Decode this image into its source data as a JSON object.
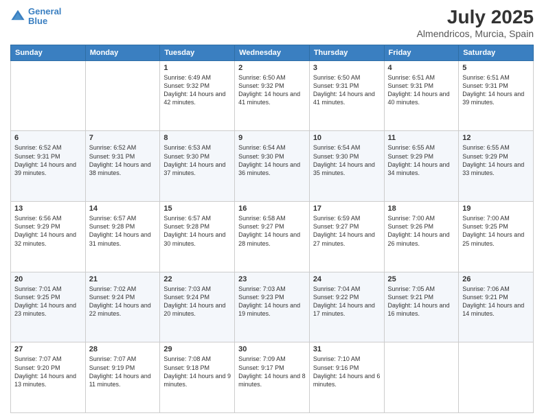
{
  "header": {
    "logo_line1": "General",
    "logo_line2": "Blue",
    "month_year": "July 2025",
    "location": "Almendricos, Murcia, Spain"
  },
  "weekdays": [
    "Sunday",
    "Monday",
    "Tuesday",
    "Wednesday",
    "Thursday",
    "Friday",
    "Saturday"
  ],
  "weeks": [
    [
      {
        "day": "",
        "info": ""
      },
      {
        "day": "",
        "info": ""
      },
      {
        "day": "1",
        "sunrise": "Sunrise: 6:49 AM",
        "sunset": "Sunset: 9:32 PM",
        "daylight": "Daylight: 14 hours and 42 minutes."
      },
      {
        "day": "2",
        "sunrise": "Sunrise: 6:50 AM",
        "sunset": "Sunset: 9:32 PM",
        "daylight": "Daylight: 14 hours and 41 minutes."
      },
      {
        "day": "3",
        "sunrise": "Sunrise: 6:50 AM",
        "sunset": "Sunset: 9:31 PM",
        "daylight": "Daylight: 14 hours and 41 minutes."
      },
      {
        "day": "4",
        "sunrise": "Sunrise: 6:51 AM",
        "sunset": "Sunset: 9:31 PM",
        "daylight": "Daylight: 14 hours and 40 minutes."
      },
      {
        "day": "5",
        "sunrise": "Sunrise: 6:51 AM",
        "sunset": "Sunset: 9:31 PM",
        "daylight": "Daylight: 14 hours and 39 minutes."
      }
    ],
    [
      {
        "day": "6",
        "sunrise": "Sunrise: 6:52 AM",
        "sunset": "Sunset: 9:31 PM",
        "daylight": "Daylight: 14 hours and 39 minutes."
      },
      {
        "day": "7",
        "sunrise": "Sunrise: 6:52 AM",
        "sunset": "Sunset: 9:31 PM",
        "daylight": "Daylight: 14 hours and 38 minutes."
      },
      {
        "day": "8",
        "sunrise": "Sunrise: 6:53 AM",
        "sunset": "Sunset: 9:30 PM",
        "daylight": "Daylight: 14 hours and 37 minutes."
      },
      {
        "day": "9",
        "sunrise": "Sunrise: 6:54 AM",
        "sunset": "Sunset: 9:30 PM",
        "daylight": "Daylight: 14 hours and 36 minutes."
      },
      {
        "day": "10",
        "sunrise": "Sunrise: 6:54 AM",
        "sunset": "Sunset: 9:30 PM",
        "daylight": "Daylight: 14 hours and 35 minutes."
      },
      {
        "day": "11",
        "sunrise": "Sunrise: 6:55 AM",
        "sunset": "Sunset: 9:29 PM",
        "daylight": "Daylight: 14 hours and 34 minutes."
      },
      {
        "day": "12",
        "sunrise": "Sunrise: 6:55 AM",
        "sunset": "Sunset: 9:29 PM",
        "daylight": "Daylight: 14 hours and 33 minutes."
      }
    ],
    [
      {
        "day": "13",
        "sunrise": "Sunrise: 6:56 AM",
        "sunset": "Sunset: 9:29 PM",
        "daylight": "Daylight: 14 hours and 32 minutes."
      },
      {
        "day": "14",
        "sunrise": "Sunrise: 6:57 AM",
        "sunset": "Sunset: 9:28 PM",
        "daylight": "Daylight: 14 hours and 31 minutes."
      },
      {
        "day": "15",
        "sunrise": "Sunrise: 6:57 AM",
        "sunset": "Sunset: 9:28 PM",
        "daylight": "Daylight: 14 hours and 30 minutes."
      },
      {
        "day": "16",
        "sunrise": "Sunrise: 6:58 AM",
        "sunset": "Sunset: 9:27 PM",
        "daylight": "Daylight: 14 hours and 28 minutes."
      },
      {
        "day": "17",
        "sunrise": "Sunrise: 6:59 AM",
        "sunset": "Sunset: 9:27 PM",
        "daylight": "Daylight: 14 hours and 27 minutes."
      },
      {
        "day": "18",
        "sunrise": "Sunrise: 7:00 AM",
        "sunset": "Sunset: 9:26 PM",
        "daylight": "Daylight: 14 hours and 26 minutes."
      },
      {
        "day": "19",
        "sunrise": "Sunrise: 7:00 AM",
        "sunset": "Sunset: 9:25 PM",
        "daylight": "Daylight: 14 hours and 25 minutes."
      }
    ],
    [
      {
        "day": "20",
        "sunrise": "Sunrise: 7:01 AM",
        "sunset": "Sunset: 9:25 PM",
        "daylight": "Daylight: 14 hours and 23 minutes."
      },
      {
        "day": "21",
        "sunrise": "Sunrise: 7:02 AM",
        "sunset": "Sunset: 9:24 PM",
        "daylight": "Daylight: 14 hours and 22 minutes."
      },
      {
        "day": "22",
        "sunrise": "Sunrise: 7:03 AM",
        "sunset": "Sunset: 9:24 PM",
        "daylight": "Daylight: 14 hours and 20 minutes."
      },
      {
        "day": "23",
        "sunrise": "Sunrise: 7:03 AM",
        "sunset": "Sunset: 9:23 PM",
        "daylight": "Daylight: 14 hours and 19 minutes."
      },
      {
        "day": "24",
        "sunrise": "Sunrise: 7:04 AM",
        "sunset": "Sunset: 9:22 PM",
        "daylight": "Daylight: 14 hours and 17 minutes."
      },
      {
        "day": "25",
        "sunrise": "Sunrise: 7:05 AM",
        "sunset": "Sunset: 9:21 PM",
        "daylight": "Daylight: 14 hours and 16 minutes."
      },
      {
        "day": "26",
        "sunrise": "Sunrise: 7:06 AM",
        "sunset": "Sunset: 9:21 PM",
        "daylight": "Daylight: 14 hours and 14 minutes."
      }
    ],
    [
      {
        "day": "27",
        "sunrise": "Sunrise: 7:07 AM",
        "sunset": "Sunset: 9:20 PM",
        "daylight": "Daylight: 14 hours and 13 minutes."
      },
      {
        "day": "28",
        "sunrise": "Sunrise: 7:07 AM",
        "sunset": "Sunset: 9:19 PM",
        "daylight": "Daylight: 14 hours and 11 minutes."
      },
      {
        "day": "29",
        "sunrise": "Sunrise: 7:08 AM",
        "sunset": "Sunset: 9:18 PM",
        "daylight": "Daylight: 14 hours and 9 minutes."
      },
      {
        "day": "30",
        "sunrise": "Sunrise: 7:09 AM",
        "sunset": "Sunset: 9:17 PM",
        "daylight": "Daylight: 14 hours and 8 minutes."
      },
      {
        "day": "31",
        "sunrise": "Sunrise: 7:10 AM",
        "sunset": "Sunset: 9:16 PM",
        "daylight": "Daylight: 14 hours and 6 minutes."
      },
      {
        "day": "",
        "info": ""
      },
      {
        "day": "",
        "info": ""
      }
    ]
  ]
}
